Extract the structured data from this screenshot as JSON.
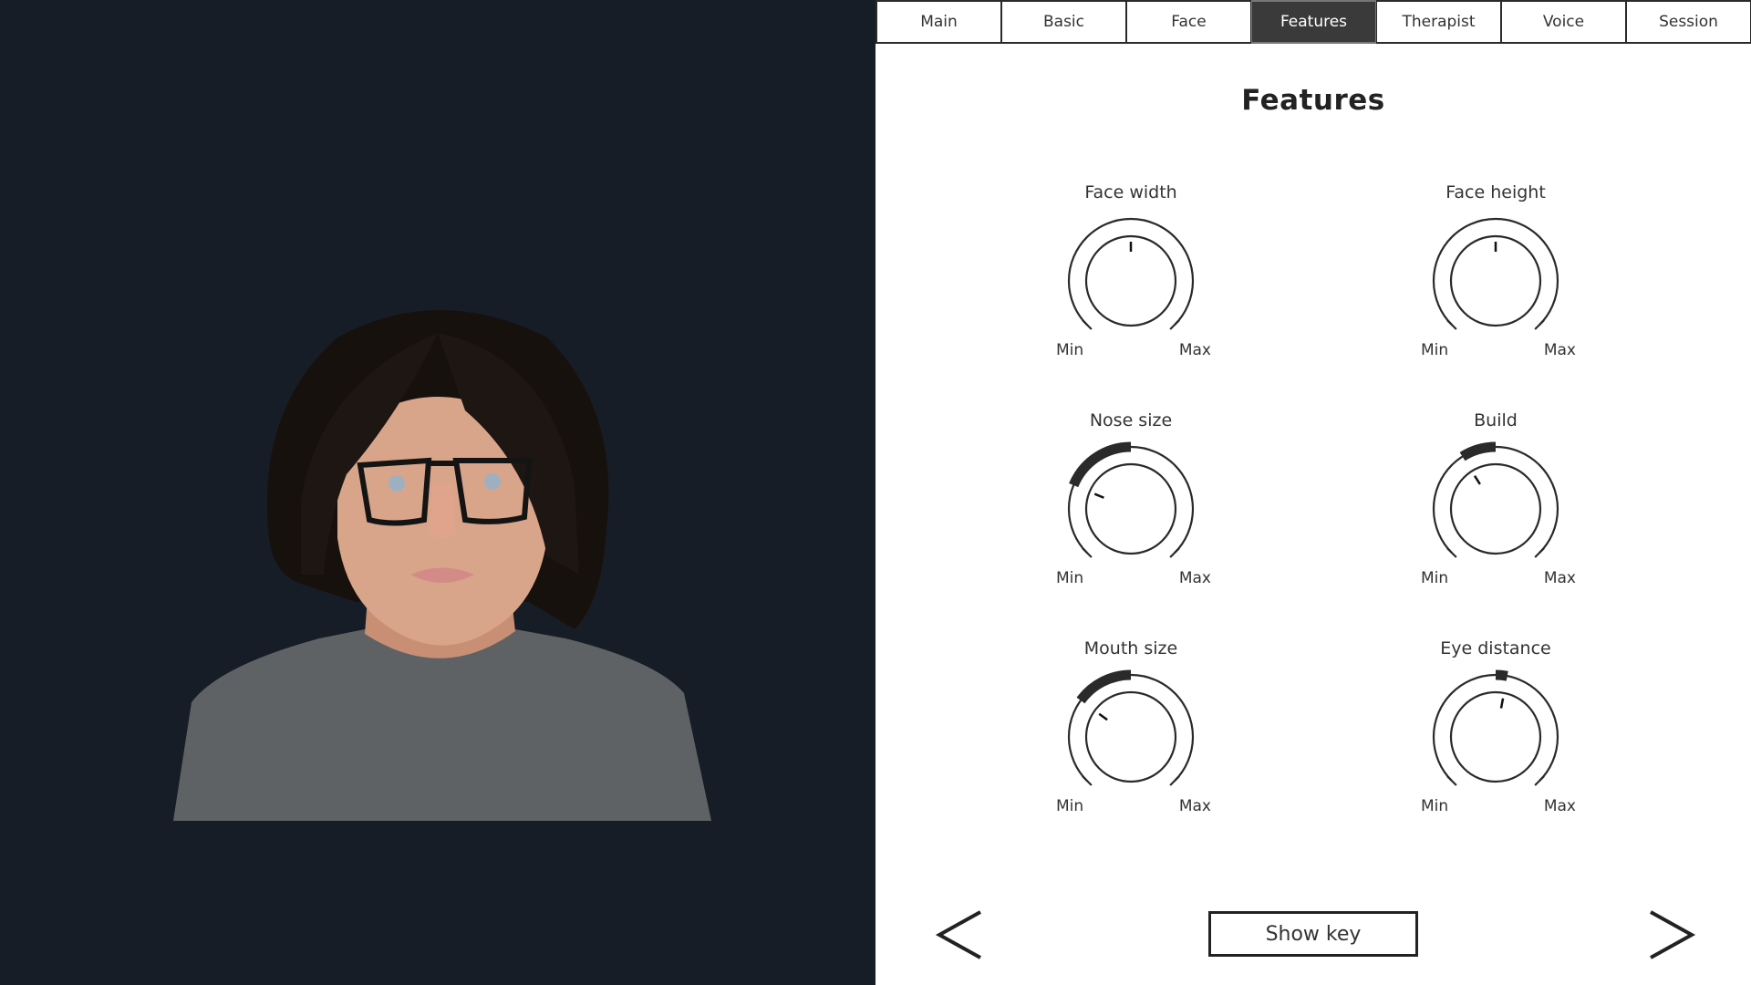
{
  "tabs": [
    {
      "label": "Main",
      "active": false
    },
    {
      "label": "Basic",
      "active": false
    },
    {
      "label": "Face",
      "active": false
    },
    {
      "label": "Features",
      "active": true
    },
    {
      "label": "Therapist",
      "active": false
    },
    {
      "label": "Voice",
      "active": false
    },
    {
      "label": "Session",
      "active": false
    }
  ],
  "panel": {
    "title": "Features",
    "min_label": "Min",
    "max_label": "Max",
    "knobs": [
      {
        "label": "Face width",
        "value": 0.5
      },
      {
        "label": "Face height",
        "value": 0.5
      },
      {
        "label": "Nose size",
        "value": 0.25
      },
      {
        "label": "Build",
        "value": 0.38
      },
      {
        "label": "Mouth size",
        "value": 0.3
      },
      {
        "label": "Eye distance",
        "value": 0.54
      }
    ]
  },
  "footer": {
    "prev_icon": "chevron-left-icon",
    "show_key_label": "Show key",
    "next_icon": "chevron-right-icon"
  },
  "avatar": {
    "description": "3D avatar of a woman with dark bob hair, glasses, grey t-shirt",
    "colors": {
      "background": "#161d26",
      "hair": "#1a1410",
      "skin": "#d9a58a",
      "shirt": "#5e6264",
      "glasses": "#141414"
    }
  }
}
